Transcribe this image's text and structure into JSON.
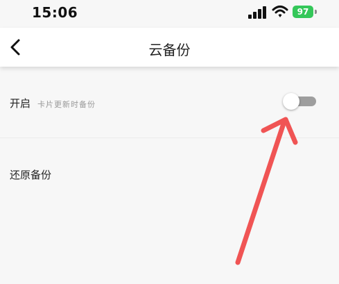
{
  "status_bar": {
    "time": "15:06",
    "battery_level": "97",
    "battery_color": "#34c759"
  },
  "nav": {
    "title": "云备份",
    "back_icon": "chevron-left-icon"
  },
  "settings": {
    "open_label": "开启",
    "open_hint": "卡片更新时备份",
    "toggle_on": false,
    "restore_label": "还原备份"
  },
  "annotation": {
    "arrow_color": "#f05454"
  }
}
